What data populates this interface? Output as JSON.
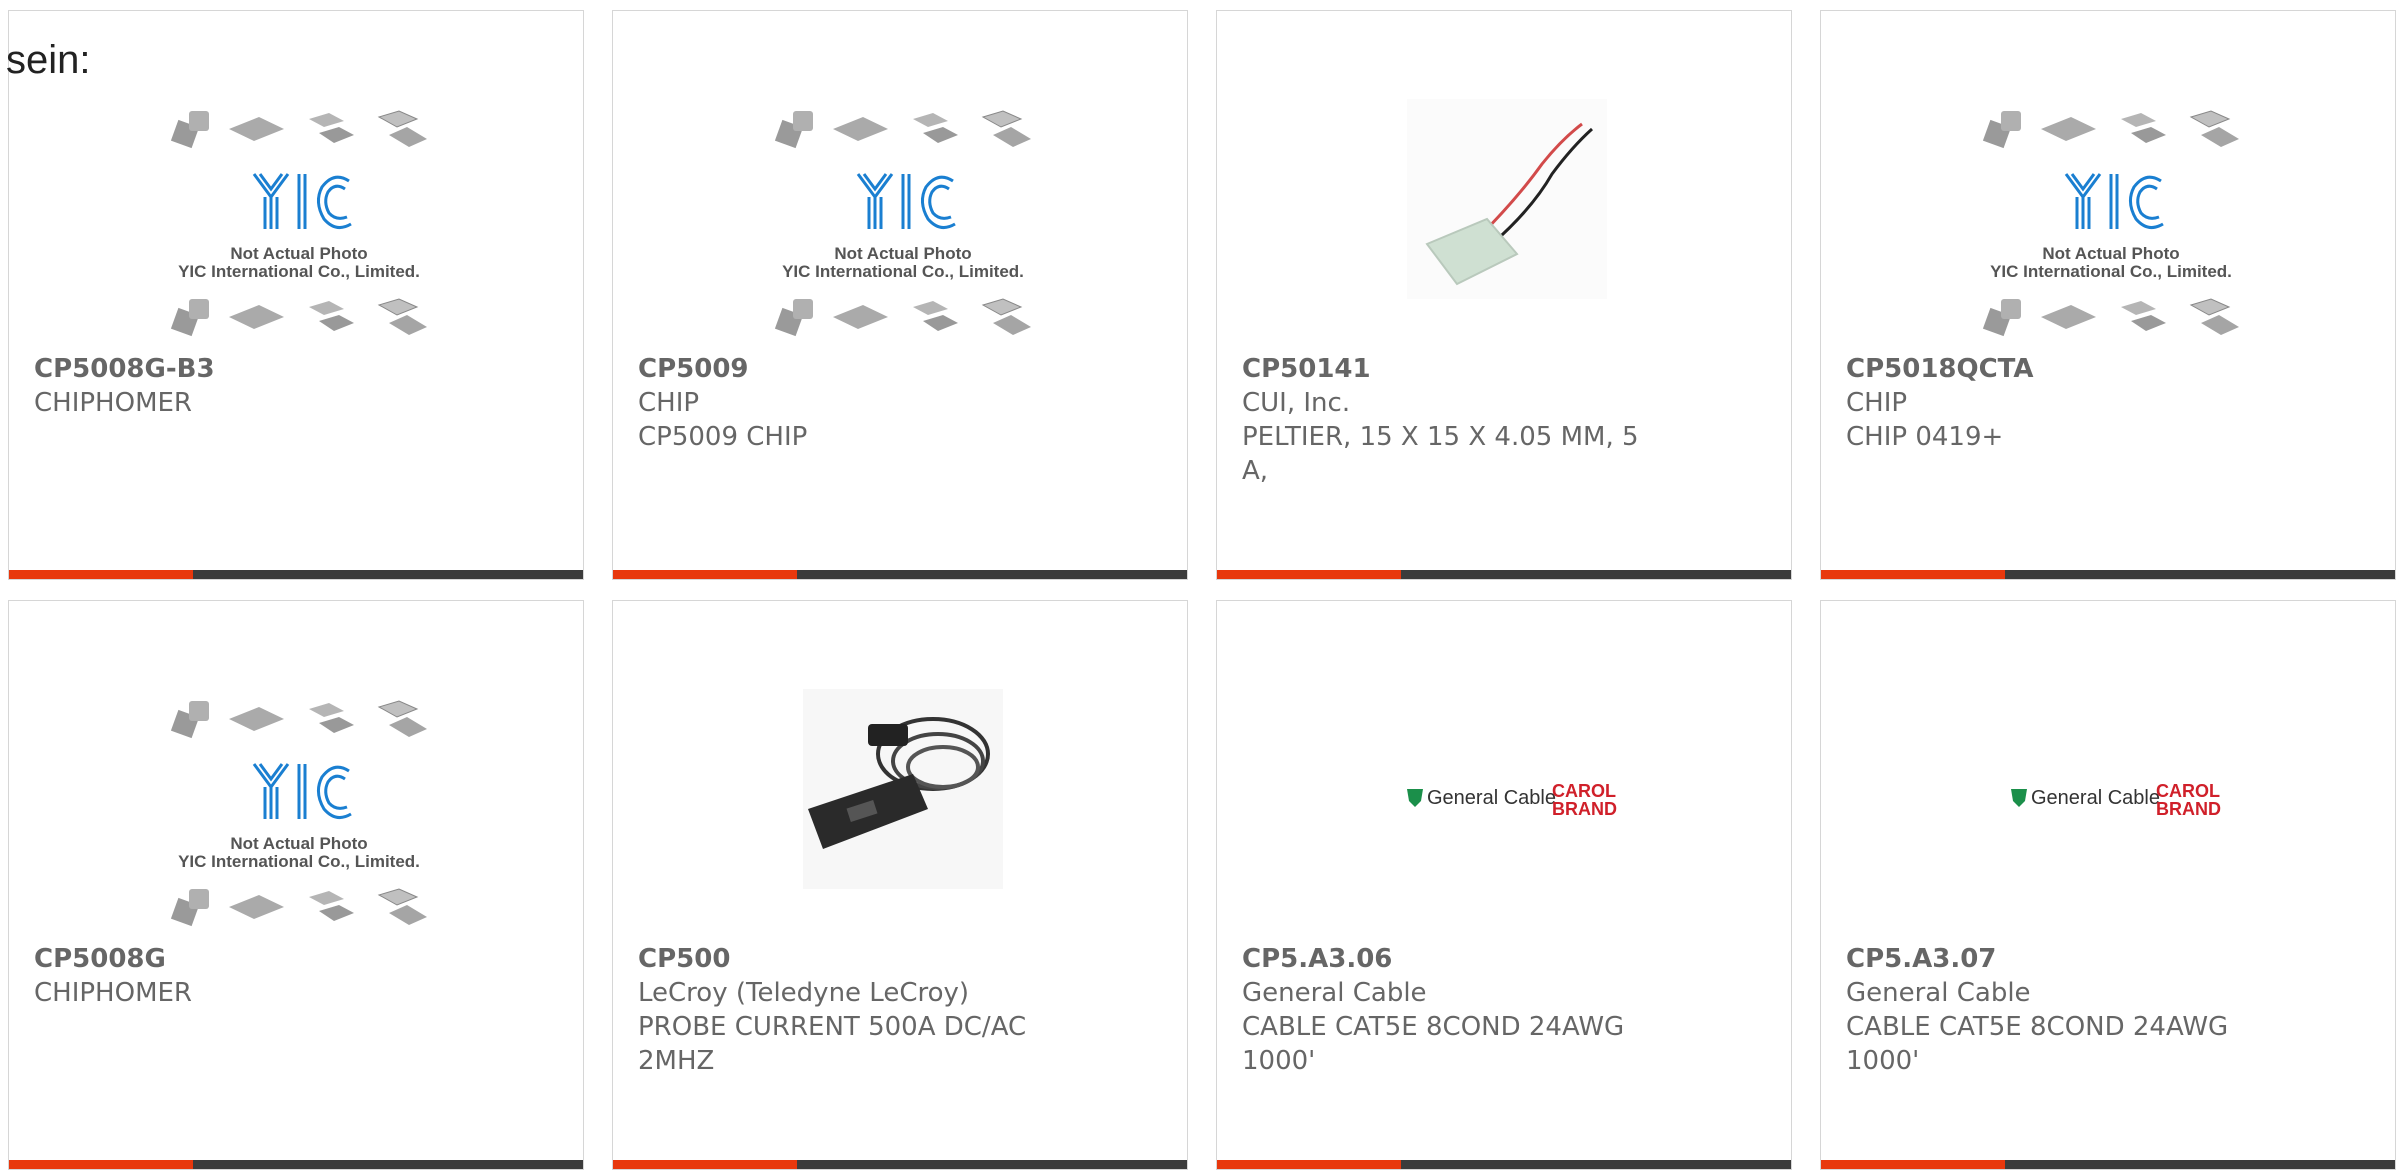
{
  "page_label": "sein:",
  "placeholder": {
    "logo": "YIC",
    "caption1": "Not Actual Photo",
    "caption2": "YIC International Co., Limited."
  },
  "products": [
    {
      "part": "CP5008G-B3",
      "lines": [
        "CHIPHOMER"
      ],
      "image": "yic-placeholder"
    },
    {
      "part": "CP5009",
      "lines": [
        "CHIP",
        "CP5009 CHIP"
      ],
      "image": "yic-placeholder"
    },
    {
      "part": "CP50141",
      "lines": [
        "CUI, Inc.",
        "PELTIER, 15 X 15 X 4.05 MM, 5",
        "A,"
      ],
      "image": "peltier-module"
    },
    {
      "part": "CP5018QCTA",
      "lines": [
        "CHIP",
        "CHIP 0419+"
      ],
      "image": "yic-placeholder"
    },
    {
      "part": "CP5008G",
      "lines": [
        "CHIPHOMER"
      ],
      "image": "yic-placeholder"
    },
    {
      "part": "CP500",
      "lines": [
        "LeCroy (Teledyne LeCroy)",
        "PROBE CURRENT 500A DC/AC",
        "2MHZ"
      ],
      "image": "current-probe"
    },
    {
      "part": "CP5.A3.06",
      "lines": [
        "General Cable",
        "CABLE CAT5E 8COND 24AWG",
        "1000'"
      ],
      "image": "general-cable-logo"
    },
    {
      "part": "CP5.A3.07",
      "lines": [
        "General Cable",
        "CABLE CAT5E 8COND 24AWG",
        "1000'"
      ],
      "image": "general-cable-logo"
    }
  ],
  "brand_logo": {
    "left": "General Cable",
    "right_top": "CAROL",
    "right_bottom": "BRAND"
  },
  "colors": {
    "accent": "#e8380d",
    "bar": "#3c3c3c",
    "logo_blue": "#1a7fd1",
    "carol_red": "#d0202a"
  }
}
